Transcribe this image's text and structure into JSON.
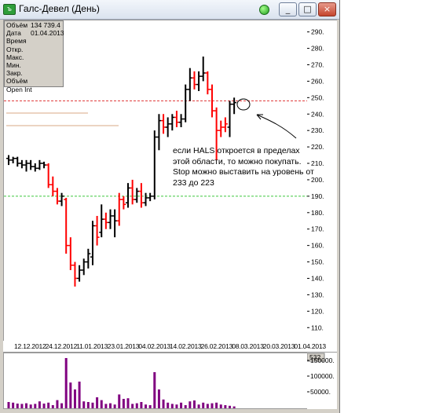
{
  "window": {
    "title": "Галс-Девел (День)",
    "icon": "chart-app-icon",
    "buttons": {
      "minimize": "_",
      "maximize": "□",
      "close": "×"
    }
  },
  "info_panel": {
    "rows": [
      {
        "label": "Объём",
        "value": "134 739.4"
      },
      {
        "label": "Дата",
        "value": "01.04.2013"
      },
      {
        "label": "Время",
        "value": ""
      },
      {
        "label": "Откр.",
        "value": ""
      },
      {
        "label": "Макс.",
        "value": ""
      },
      {
        "label": "Мин.",
        "value": ""
      },
      {
        "label": "Закр.",
        "value": ""
      },
      {
        "label": "Объём",
        "value": ""
      },
      {
        "label": "Open Int",
        "value": ""
      }
    ]
  },
  "annotation": {
    "text": "если HALS откроется в пределах этой области, то можно покупать. Stop можно выставить на уровень от 233 до 223"
  },
  "chart_data": {
    "type": "ohlc",
    "y_ticks": [
      "290.",
      "280.",
      "270.",
      "260.",
      "250.",
      "240.",
      "230.",
      "220.",
      "210.",
      "200.",
      "190.",
      "180.",
      "170.",
      "160.",
      "150.",
      "140.",
      "130.",
      "120.",
      "110."
    ],
    "ylim": [
      102,
      297
    ],
    "x_tick_labels": [
      "12.12.2012",
      "24.12.2012",
      "11.01.2013",
      "23.01.2013",
      "04.02.2013",
      "14.02.2013",
      "26.02.2013",
      "08.03.2013",
      "20.03.2013",
      "01.04.2013"
    ],
    "levels": [
      {
        "value": 248,
        "color": "#e03c3c",
        "style": "dashed"
      },
      {
        "value": 190,
        "color": "#3cc83c",
        "style": "dashed"
      }
    ],
    "bars": [
      {
        "o": 213,
        "h": 215,
        "l": 209,
        "c": 212,
        "col": "black"
      },
      {
        "o": 212,
        "h": 214,
        "l": 210,
        "c": 213,
        "col": "black"
      },
      {
        "o": 213,
        "h": 214,
        "l": 208,
        "c": 210,
        "col": "black"
      },
      {
        "o": 210,
        "h": 212,
        "l": 207,
        "c": 209,
        "col": "black"
      },
      {
        "o": 209,
        "h": 212,
        "l": 205,
        "c": 210,
        "col": "black"
      },
      {
        "o": 210,
        "h": 212,
        "l": 206,
        "c": 208,
        "col": "black"
      },
      {
        "o": 208,
        "h": 210,
        "l": 205,
        "c": 207,
        "col": "black"
      },
      {
        "o": 207,
        "h": 212,
        "l": 206,
        "c": 210,
        "col": "black"
      },
      {
        "o": 210,
        "h": 211,
        "l": 207,
        "c": 209,
        "col": "black"
      },
      {
        "o": 209,
        "h": 210,
        "l": 195,
        "c": 197,
        "col": "red"
      },
      {
        "o": 197,
        "h": 202,
        "l": 190,
        "c": 193,
        "col": "red"
      },
      {
        "o": 193,
        "h": 195,
        "l": 185,
        "c": 187,
        "col": "red"
      },
      {
        "o": 187,
        "h": 192,
        "l": 184,
        "c": 190,
        "col": "black"
      },
      {
        "o": 188,
        "h": 189,
        "l": 155,
        "c": 160,
        "col": "red"
      },
      {
        "o": 160,
        "h": 165,
        "l": 145,
        "c": 148,
        "col": "red"
      },
      {
        "o": 148,
        "h": 150,
        "l": 135,
        "c": 140,
        "col": "red"
      },
      {
        "o": 140,
        "h": 148,
        "l": 138,
        "c": 145,
        "col": "black"
      },
      {
        "o": 145,
        "h": 152,
        "l": 142,
        "c": 150,
        "col": "black"
      },
      {
        "o": 150,
        "h": 158,
        "l": 146,
        "c": 155,
        "col": "black"
      },
      {
        "o": 153,
        "h": 175,
        "l": 148,
        "c": 172,
        "col": "black"
      },
      {
        "o": 172,
        "h": 178,
        "l": 160,
        "c": 165,
        "col": "red"
      },
      {
        "o": 168,
        "h": 185,
        "l": 165,
        "c": 176,
        "col": "black"
      },
      {
        "o": 176,
        "h": 180,
        "l": 170,
        "c": 174,
        "col": "red"
      },
      {
        "o": 174,
        "h": 182,
        "l": 170,
        "c": 178,
        "col": "black"
      },
      {
        "o": 178,
        "h": 182,
        "l": 165,
        "c": 175,
        "col": "black"
      },
      {
        "o": 175,
        "h": 192,
        "l": 172,
        "c": 188,
        "col": "red"
      },
      {
        "o": 188,
        "h": 190,
        "l": 182,
        "c": 185,
        "col": "red"
      },
      {
        "o": 186,
        "h": 198,
        "l": 183,
        "c": 195,
        "col": "black"
      },
      {
        "o": 195,
        "h": 200,
        "l": 185,
        "c": 188,
        "col": "red"
      },
      {
        "o": 188,
        "h": 195,
        "l": 186,
        "c": 193,
        "col": "black"
      },
      {
        "o": 193,
        "h": 198,
        "l": 183,
        "c": 186,
        "col": "red"
      },
      {
        "o": 186,
        "h": 192,
        "l": 184,
        "c": 189,
        "col": "black"
      },
      {
        "o": 189,
        "h": 192,
        "l": 187,
        "c": 190,
        "col": "black"
      },
      {
        "o": 190,
        "h": 230,
        "l": 188,
        "c": 226,
        "col": "black"
      },
      {
        "o": 226,
        "h": 240,
        "l": 218,
        "c": 236,
        "col": "black"
      },
      {
        "o": 236,
        "h": 240,
        "l": 228,
        "c": 232,
        "col": "red"
      },
      {
        "o": 232,
        "h": 238,
        "l": 226,
        "c": 234,
        "col": "black"
      },
      {
        "o": 234,
        "h": 240,
        "l": 230,
        "c": 238,
        "col": "black"
      },
      {
        "o": 238,
        "h": 242,
        "l": 232,
        "c": 235,
        "col": "red"
      },
      {
        "o": 235,
        "h": 240,
        "l": 232,
        "c": 237,
        "col": "black"
      },
      {
        "o": 237,
        "h": 258,
        "l": 235,
        "c": 255,
        "col": "black"
      },
      {
        "o": 255,
        "h": 268,
        "l": 248,
        "c": 262,
        "col": "black"
      },
      {
        "o": 262,
        "h": 266,
        "l": 255,
        "c": 258,
        "col": "red"
      },
      {
        "o": 258,
        "h": 266,
        "l": 254,
        "c": 263,
        "col": "black"
      },
      {
        "o": 263,
        "h": 275,
        "l": 260,
        "c": 265,
        "col": "black"
      },
      {
        "o": 265,
        "h": 266,
        "l": 252,
        "c": 255,
        "col": "red"
      },
      {
        "o": 255,
        "h": 258,
        "l": 238,
        "c": 242,
        "col": "red"
      },
      {
        "o": 242,
        "h": 244,
        "l": 212,
        "c": 230,
        "col": "red"
      },
      {
        "o": 230,
        "h": 236,
        "l": 226,
        "c": 232,
        "col": "red"
      },
      {
        "o": 232,
        "h": 238,
        "l": 229,
        "c": 234,
        "col": "red"
      },
      {
        "o": 232,
        "h": 248,
        "l": 226,
        "c": 246,
        "col": "black"
      },
      {
        "o": 246,
        "h": 250,
        "l": 240,
        "c": 247,
        "col": "black"
      }
    ],
    "volumes": [
      20000,
      18000,
      15000,
      14000,
      16000,
      12000,
      14000,
      22000,
      15000,
      18000,
      10000,
      26000,
      16000,
      160000,
      82000,
      60000,
      85000,
      22000,
      20000,
      18000,
      35000,
      26000,
      14000,
      16000,
      12000,
      44000,
      30000,
      32000,
      14000,
      16000,
      20000,
      12000,
      10000,
      115000,
      60000,
      28000,
      18000,
      14000,
      12000,
      18000,
      10000,
      22000,
      25000,
      12000,
      18000,
      14000,
      16000,
      18000,
      12000,
      10000,
      8000,
      6000
    ],
    "volume_ticks": [
      "150000.",
      "100000.",
      "50000."
    ],
    "volume_ylim": [
      0,
      175000
    ],
    "volume_latest_label": "532"
  },
  "colors": {
    "up": "#000000",
    "down": "#ff0000",
    "volume": "#800080"
  }
}
